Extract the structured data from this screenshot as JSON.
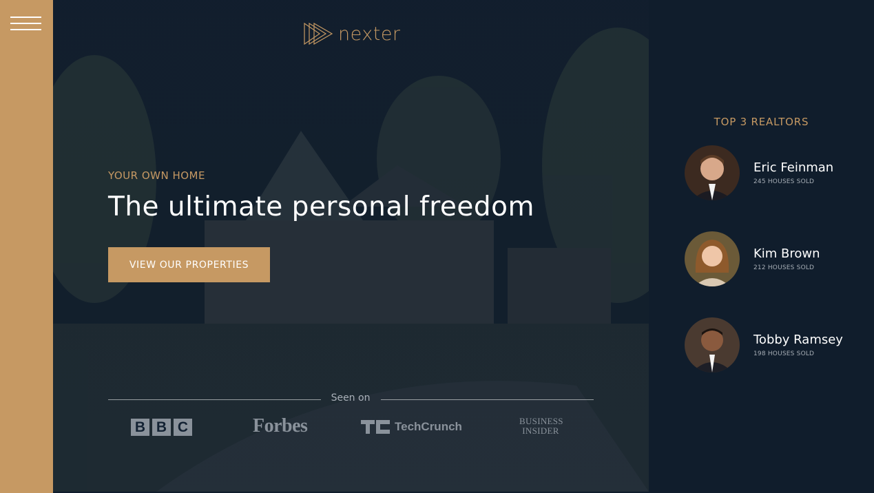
{
  "sidebar": {
    "menu_icon": "hamburger-menu-icon"
  },
  "header": {
    "logo_icon": "play-triangles-logo-icon",
    "logo_text": "nexter"
  },
  "hero": {
    "eyebrow": "YOUR OWN HOME",
    "headline": "The ultimate personal freedom",
    "cta_label": "VIEW OUR PROPERTIES",
    "seen_on_label": "Seen on",
    "press": [
      {
        "name": "BBC",
        "letters": [
          "B",
          "B",
          "C"
        ]
      },
      {
        "name": "Forbes"
      },
      {
        "name": "TechCrunch",
        "icon": "techcrunch-tc-icon"
      },
      {
        "name": "Business Insider",
        "line1": "BUSINESS",
        "line2": "INSIDER"
      }
    ]
  },
  "realtors": {
    "title": "TOP 3 REALTORS",
    "items": [
      {
        "name": "Eric Feinman",
        "sold": "245 HOUSES SOLD"
      },
      {
        "name": "Kim Brown",
        "sold": "212 HOUSES SOLD"
      },
      {
        "name": "Tobby Ramsey",
        "sold": "198 HOUSES SOLD"
      }
    ]
  },
  "colors": {
    "primary": "#c69963",
    "dark": "#101d2c",
    "white": "#ffffff"
  }
}
